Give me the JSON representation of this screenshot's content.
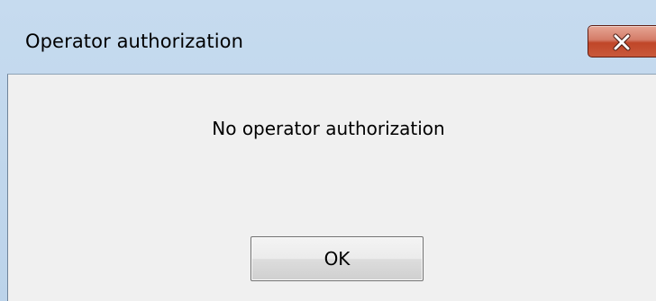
{
  "dialog": {
    "title": "Operator authorization",
    "close_icon": "close-icon",
    "message": "No operator authorization",
    "ok_label": "OK"
  },
  "colors": {
    "frame": "#c6dbef",
    "client_background": "#f0f0f0",
    "close_button": "#c9593b",
    "text": "#000000"
  }
}
